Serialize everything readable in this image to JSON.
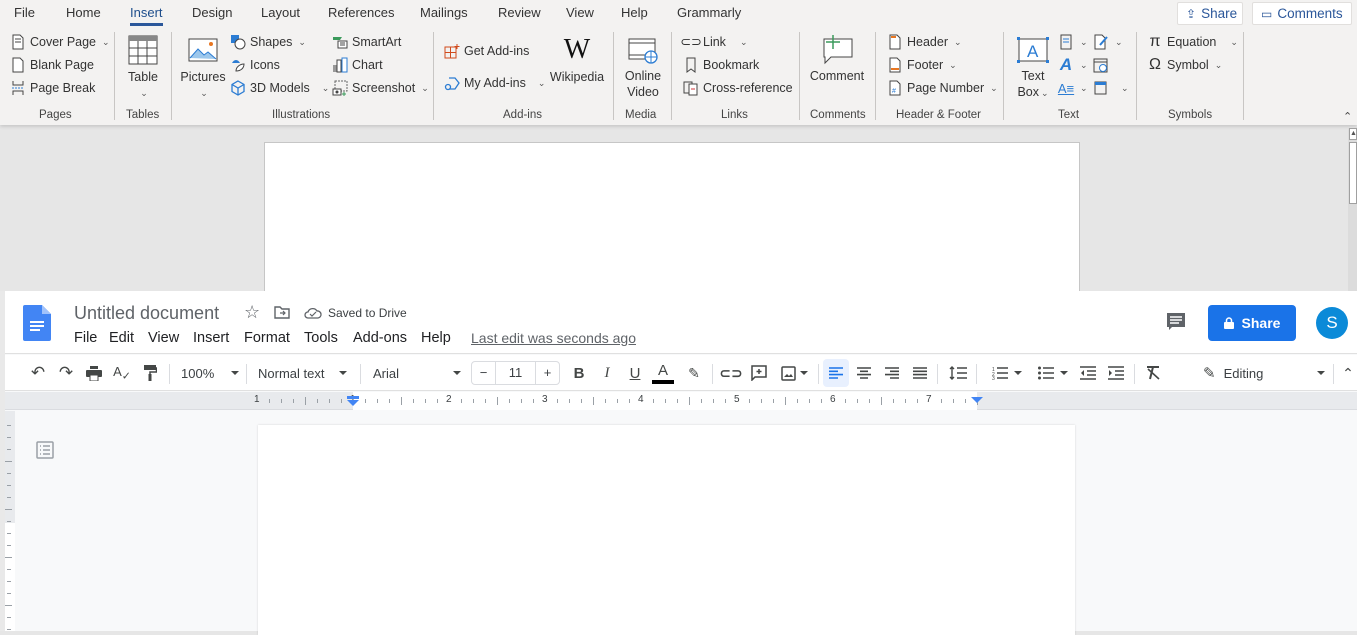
{
  "word": {
    "tabs": [
      "File",
      "Home",
      "Insert",
      "Design",
      "Layout",
      "References",
      "Mailings",
      "Review",
      "View",
      "Help",
      "Grammarly"
    ],
    "active_tab": "Insert",
    "top_buttons": {
      "share": "Share",
      "comments": "Comments"
    },
    "groups": {
      "pages": {
        "label": "Pages",
        "items": [
          "Cover Page",
          "Blank Page",
          "Page Break"
        ]
      },
      "tables": {
        "label": "Tables",
        "items": [
          "Table"
        ]
      },
      "illustrations": {
        "label": "Illustrations",
        "pictures": "Pictures",
        "items": [
          "Shapes",
          "Icons",
          "3D Models",
          "SmartArt",
          "Chart",
          "Screenshot"
        ]
      },
      "addins": {
        "label": "Add-ins",
        "items": [
          "Get Add-ins",
          "My Add-ins"
        ],
        "wikipedia": "Wikipedia"
      },
      "media": {
        "label": "Media",
        "online_video_1": "Online",
        "online_video_2": "Video"
      },
      "links": {
        "label": "Links",
        "items": [
          "Link",
          "Bookmark",
          "Cross-reference"
        ]
      },
      "comments": {
        "label": "Comments",
        "comment": "Comment"
      },
      "header_footer": {
        "label": "Header & Footer",
        "items": [
          "Header",
          "Footer",
          "Page Number"
        ]
      },
      "text": {
        "label": "Text",
        "text_box_1": "Text",
        "text_box_2": "Box"
      },
      "symbols": {
        "label": "Symbols",
        "items": [
          "Equation",
          "Symbol"
        ]
      }
    },
    "colors": {
      "accent": "#2b579a",
      "ribbon_bg": "#f3f2f1",
      "canvas_bg": "#e6e6e6"
    }
  },
  "gdocs": {
    "title": "Untitled document",
    "save_status": "Saved to Drive",
    "menu": [
      "File",
      "Edit",
      "View",
      "Insert",
      "Format",
      "Tools",
      "Add-ons",
      "Help"
    ],
    "last_edit": "Last edit was seconds ago",
    "share_label": "Share",
    "avatar_initial": "S",
    "toolbar": {
      "zoom": "100%",
      "style": "Normal text",
      "font": "Arial",
      "font_size": "11",
      "mode": "Editing"
    },
    "ruler_labels": [
      "1",
      "1",
      "2",
      "3",
      "4",
      "5",
      "6",
      "7"
    ],
    "colors": {
      "accent": "#1a73e8",
      "avatar": "#0b8ad8",
      "doc_icon": "#4285f4"
    }
  }
}
